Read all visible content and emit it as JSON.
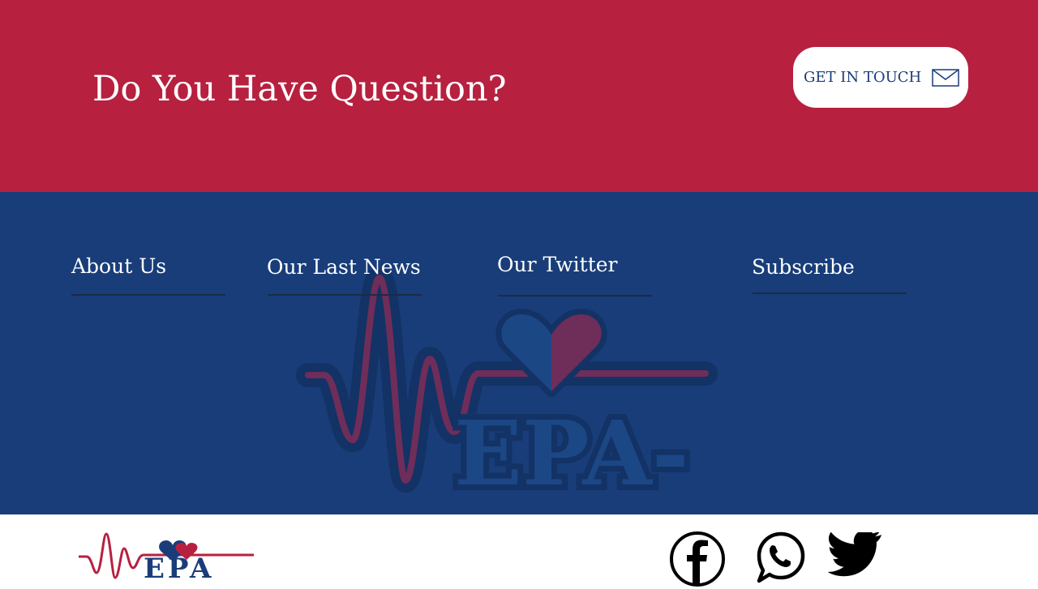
{
  "cta": {
    "title": "Do You Have Question?",
    "button_label": "GET IN TOUCH",
    "button_icon": "mail-icon",
    "background_color": "#b7203f"
  },
  "footer": {
    "background_color": "#183d79",
    "columns": [
      {
        "heading": "About Us"
      },
      {
        "heading": "Our Last News"
      },
      {
        "heading": "Our Twitter"
      },
      {
        "heading": "Subscribe"
      }
    ],
    "watermark_logo_text": "EPA-"
  },
  "bottom_bar": {
    "logo_text": "EPA",
    "social_icons": [
      "facebook-icon",
      "whatsapp-icon",
      "twitter-icon"
    ]
  }
}
